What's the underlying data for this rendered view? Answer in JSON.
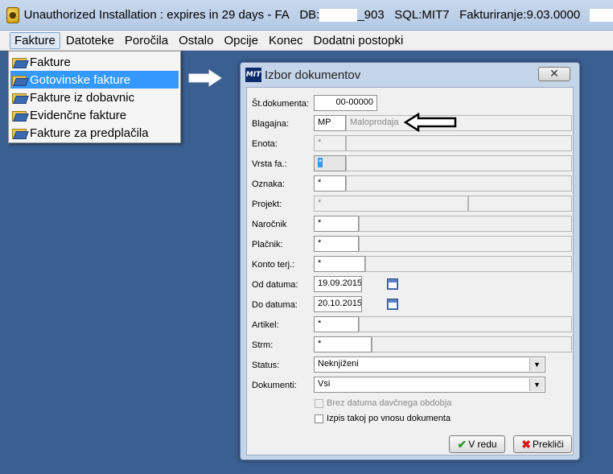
{
  "window": {
    "title_prefix": "Unauthorized Installation : expires in 29 days - FA",
    "db_label": "DB:",
    "db_suffix": "_903",
    "sql": "SQL:MIT7",
    "version": "Fakturiranje:9.03.0000"
  },
  "menu": {
    "items": [
      "Fakture",
      "Datoteke",
      "Poročila",
      "Ostalo",
      "Opcije",
      "Konec",
      "Dodatni postopki"
    ]
  },
  "dropdown": {
    "items": [
      {
        "label": "Fakture"
      },
      {
        "label": "Gotovinske fakture"
      },
      {
        "label": "Fakture iz dobavnic"
      },
      {
        "label": "Evidenčne fakture"
      },
      {
        "label": "Fakture za predplačila"
      }
    ]
  },
  "dialog": {
    "logo": "MIT",
    "title": "Izbor dokumentov",
    "close_glyph": "✕",
    "fields": {
      "st_dokumenta": {
        "label": "Št.dokumenta:",
        "value": "00-00000"
      },
      "blagajna": {
        "label": "Blagajna:",
        "code": "MP",
        "name": "Maloprodaja"
      },
      "enota": {
        "label": "Enota:",
        "value": "*"
      },
      "vrsta_fa": {
        "label": "Vrsta fa.:",
        "value": "*"
      },
      "oznaka": {
        "label": "Oznaka:",
        "value": "*"
      },
      "projekt": {
        "label": "Projekt:",
        "value": "*"
      },
      "narocnik": {
        "label": "Naročnik",
        "value": "*"
      },
      "placnik": {
        "label": "Plačnik:",
        "value": "*"
      },
      "konto_terj": {
        "label": "Konto terj.:",
        "value": "*"
      },
      "od_datuma": {
        "label": "Od datuma:",
        "value": "19.09.2015"
      },
      "do_datuma": {
        "label": "Do datuma:",
        "value": "20.10.2015"
      },
      "artikel": {
        "label": "Artikel:",
        "value": "*"
      },
      "strm": {
        "label": "Strm:",
        "value": "*"
      },
      "status": {
        "label": "Status:",
        "value": "Neknjiženi"
      },
      "dokumenti": {
        "label": "Dokumenti:",
        "value": "Vsi"
      }
    },
    "checkboxes": {
      "brez_datuma": {
        "label": "Brez datuma davčnega obdobja"
      },
      "izpis_takoj": {
        "label": "Izpis takoj po vnosu dokumenta"
      }
    },
    "buttons": {
      "ok": "V redu",
      "cancel": "Prekliči"
    }
  }
}
